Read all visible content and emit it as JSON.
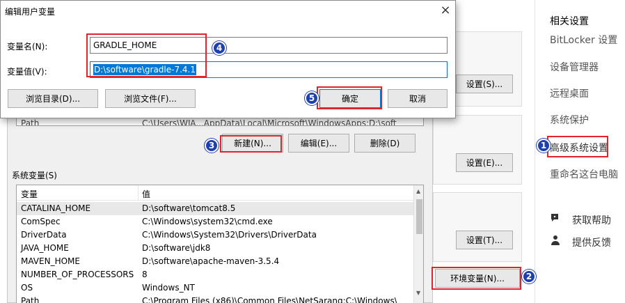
{
  "edit_dialog": {
    "title": "编辑用户变量",
    "name_label": "变量名(N):",
    "name_value": "GRADLE_HOME",
    "value_label": "变量值(V):",
    "value_value": "D:\\software\\gradle-7.4.1",
    "browse_dir_label": "浏览目录(D)...",
    "browse_file_label": "浏览文件(F)...",
    "ok_label": "确定",
    "cancel_label": "取消",
    "close_glyph": "×"
  },
  "env_dialog": {
    "user_row_partial": {
      "name": "Path",
      "value": "C:\\Users\\WJA...AppData\\Local\\Microsoft\\WindowsApps;D:\\soft"
    },
    "new_label": "新建(N)...",
    "edit_label": "编辑(E)...",
    "delete_label": "删除(D)",
    "system_vars_label": "系统变量(S)",
    "columns": [
      "变量",
      "值"
    ],
    "system_vars": [
      {
        "name": "CATALINA_HOME",
        "value": "D:\\software\\tomcat8.5"
      },
      {
        "name": "ComSpec",
        "value": "C:\\Windows\\system32\\cmd.exe"
      },
      {
        "name": "DriverData",
        "value": "C:\\Windows\\System32\\Drivers\\DriverData"
      },
      {
        "name": "JAVA_HOME",
        "value": "D:\\software\\jdk8"
      },
      {
        "name": "MAVEN_HOME",
        "value": "D:\\software\\apache-maven-3.5.4"
      },
      {
        "name": "NUMBER_OF_PROCESSORS",
        "value": "8"
      },
      {
        "name": "OS",
        "value": "Windows_NT"
      },
      {
        "name": "Path",
        "value": "C:\\Program Files (x86)\\Common Files\\NetSarang;C:\\Windows\\"
      }
    ]
  },
  "system_properties": {
    "settings_s_label": "设置(S)...",
    "settings_e_label": "设置(E)...",
    "settings_t_label": "设置(T)...",
    "env_vars_label": "环境变量(N)..."
  },
  "right_panel": {
    "title": "相关设置",
    "links": [
      "BitLocker 设置",
      "设备管理器",
      "远程桌面",
      "系统保护",
      "高级系统设置",
      "重命名这台电脑"
    ],
    "help": [
      {
        "icon": "help-chat-icon",
        "label": "获取帮助"
      },
      {
        "icon": "feedback-person-icon",
        "label": "提供反馈"
      }
    ]
  },
  "markers": [
    "1",
    "2",
    "3",
    "4",
    "5"
  ],
  "colors": {
    "highlight": "#e0242b",
    "marker": "#1f3fae",
    "selection": "#0078d7"
  }
}
